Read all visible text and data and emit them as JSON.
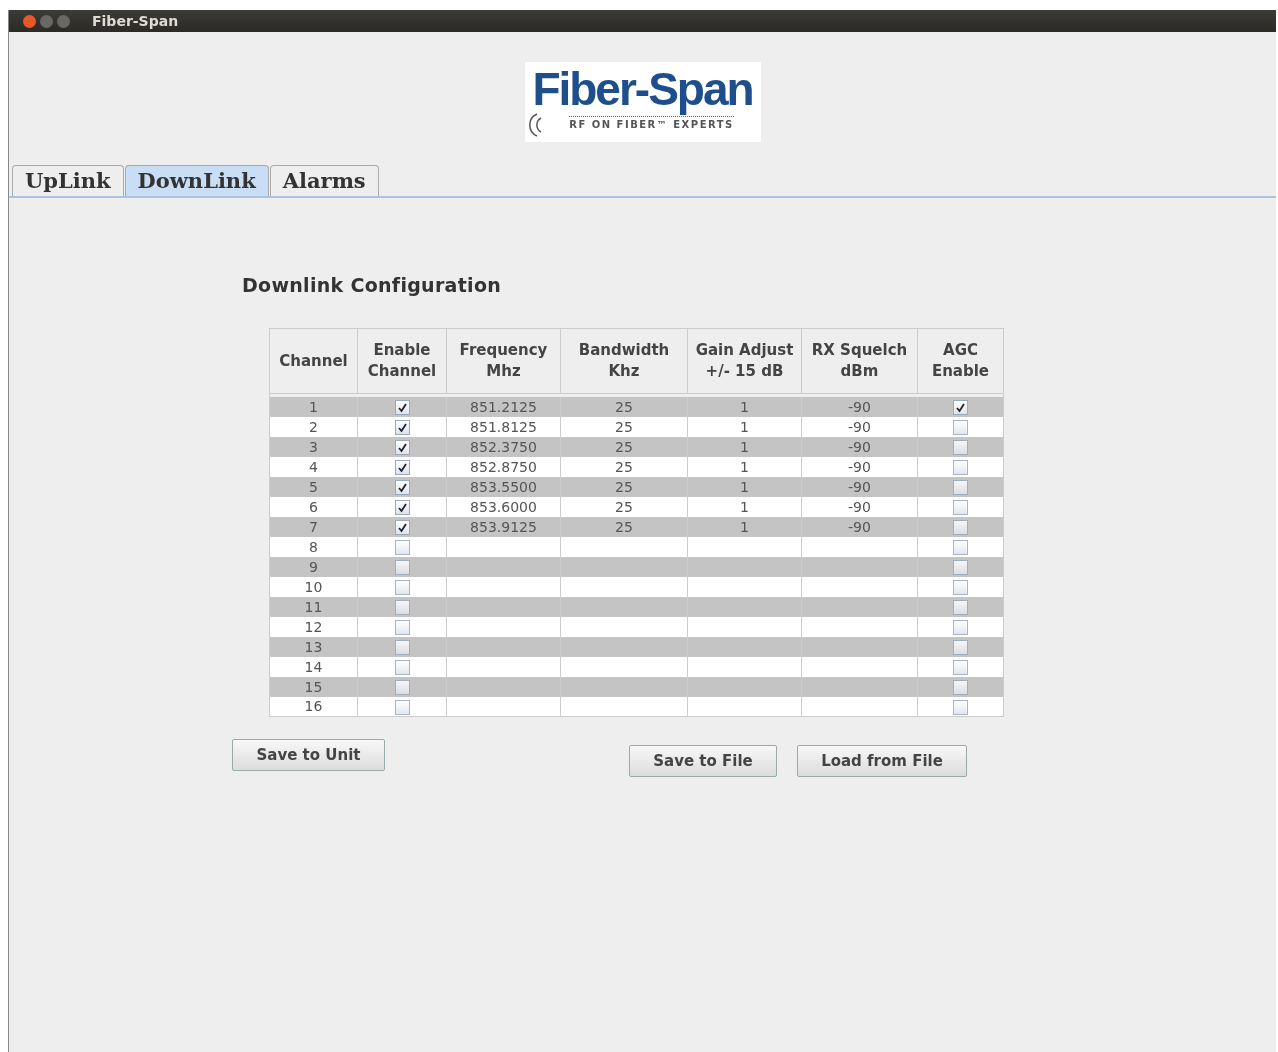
{
  "window": {
    "title": "Fiber-Span"
  },
  "logo": {
    "name": "Fiber-Span",
    "tagline": "RF ON FIBER™ EXPERTS"
  },
  "tabs": [
    {
      "label": "UpLink",
      "selected": false
    },
    {
      "label": "DownLink",
      "selected": true
    },
    {
      "label": "Alarms",
      "selected": false
    }
  ],
  "section_title": "Downlink Configuration",
  "table": {
    "columns": [
      [
        "Channel"
      ],
      [
        "Enable",
        "Channel"
      ],
      [
        "Frequency",
        "Mhz"
      ],
      [
        "Bandwidth",
        "Khz"
      ],
      [
        "Gain Adjust",
        "+/- 15 dB"
      ],
      [
        "RX Squelch",
        "dBm"
      ],
      [
        "AGC",
        "Enable"
      ]
    ],
    "rows": [
      {
        "channel": "1",
        "enabled": true,
        "frequency": "851.2125",
        "bandwidth": "25",
        "gain": "1",
        "squelch": "-90",
        "agc": true
      },
      {
        "channel": "2",
        "enabled": true,
        "frequency": "851.8125",
        "bandwidth": "25",
        "gain": "1",
        "squelch": "-90",
        "agc": false
      },
      {
        "channel": "3",
        "enabled": true,
        "frequency": "852.3750",
        "bandwidth": "25",
        "gain": "1",
        "squelch": "-90",
        "agc": false
      },
      {
        "channel": "4",
        "enabled": true,
        "frequency": "852.8750",
        "bandwidth": "25",
        "gain": "1",
        "squelch": "-90",
        "agc": false
      },
      {
        "channel": "5",
        "enabled": true,
        "frequency": "853.5500",
        "bandwidth": "25",
        "gain": "1",
        "squelch": "-90",
        "agc": false
      },
      {
        "channel": "6",
        "enabled": true,
        "frequency": "853.6000",
        "bandwidth": "25",
        "gain": "1",
        "squelch": "-90",
        "agc": false
      },
      {
        "channel": "7",
        "enabled": true,
        "frequency": "853.9125",
        "bandwidth": "25",
        "gain": "1",
        "squelch": "-90",
        "agc": false
      },
      {
        "channel": "8",
        "enabled": false,
        "agc": false
      },
      {
        "channel": "9",
        "enabled": false,
        "agc": false
      },
      {
        "channel": "10",
        "enabled": false,
        "agc": false
      },
      {
        "channel": "11",
        "enabled": false,
        "agc": false
      },
      {
        "channel": "12",
        "enabled": false,
        "agc": false
      },
      {
        "channel": "13",
        "enabled": false,
        "agc": false
      },
      {
        "channel": "14",
        "enabled": false,
        "agc": false
      },
      {
        "channel": "15",
        "enabled": false,
        "agc": false
      },
      {
        "channel": "16",
        "enabled": false,
        "agc": false
      }
    ]
  },
  "buttons": [
    "Save to Unit",
    "Save to File",
    "Load from File"
  ]
}
